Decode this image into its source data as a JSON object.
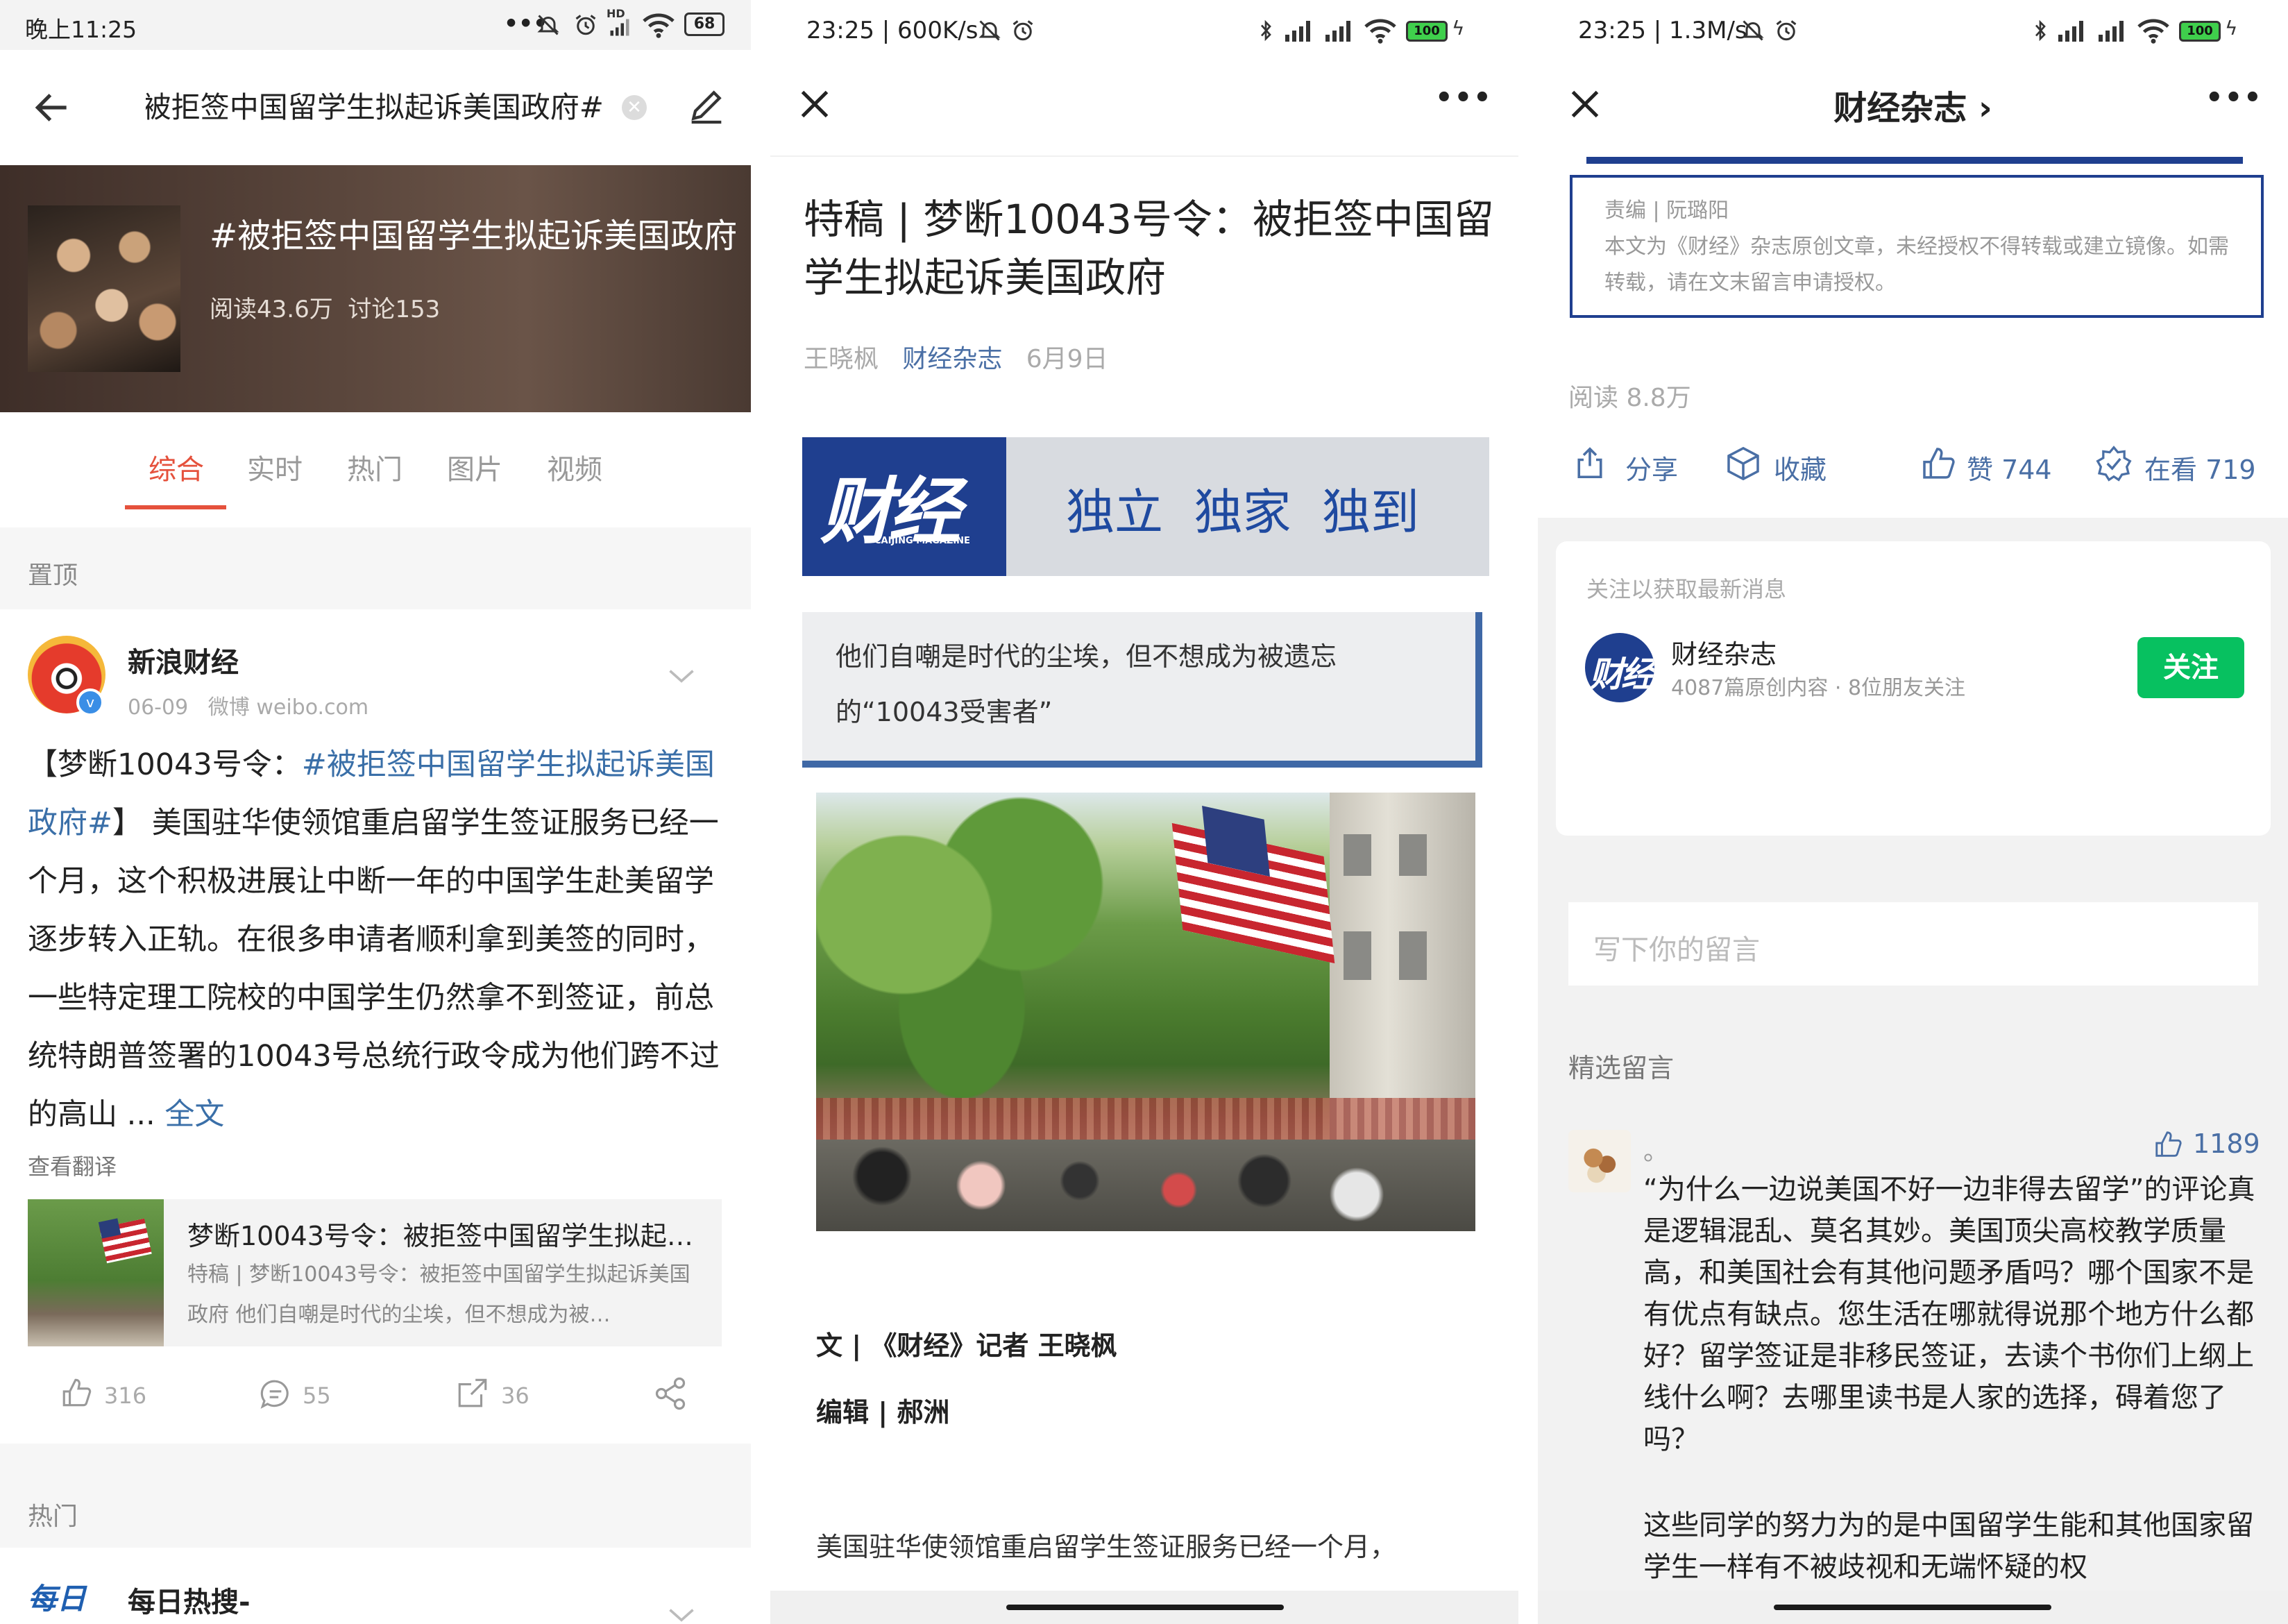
{
  "weibo": {
    "status": {
      "time": "晚上11:25",
      "signal": "HD",
      "battery": "68"
    },
    "search_query": "#被拒签中国留学生拟起诉美国政府#",
    "topic": {
      "title": "#被拒签中国留学生拟起诉美国政府",
      "reads": "阅读43.6万",
      "discussions": "讨论153"
    },
    "tabs": [
      "综合",
      "实时",
      "热门",
      "图片",
      "视频"
    ],
    "pinned_label": "置顶",
    "post": {
      "author": "新浪财经",
      "date": "06-09",
      "source": "微博 weibo.com",
      "text_prefix": "【梦断10043号令：",
      "text_tag": "#被拒签中国留学生拟起诉美国政府#",
      "text_body": "】 美国驻华使领馆重启留学生签证服务已经一个月，这个积极进展让中断一年的中国学生赴美留学逐步转入正轨。在很多申请者顺利拿到美签的同时，一些特定理工院校的中国学生仍然拿不到签证，前总统特朗普签署的10043号总统行政令成为他们跨不过的高山 ...",
      "text_full": "全文",
      "translate": "查看翻译",
      "card_title": "梦断10043号令：被拒签中国留学生拟起…",
      "card_desc": "特稿 | 梦断10043号令：被拒签中国留学生拟起诉美国政府 他们自嘲是时代的尘埃，但不想成为被…",
      "likes": "316",
      "comments": "55",
      "reposts": "36"
    },
    "hot_label": "热门",
    "next_author": "每日热搜-",
    "next_logo": "每日"
  },
  "article": {
    "status": {
      "time": "23:25 | 600K/s",
      "battery": "100"
    },
    "title": "特稿 | 梦断10043号令：被拒签中国留学生拟起诉美国政府",
    "author": "王晓枫",
    "account": "财经杂志",
    "date": "6月9日",
    "banner_logo": "财经",
    "banner_logo_en": "CAIJING MAGAZINE",
    "banner_slogan": "独立  独家  独到",
    "quote": "他们自嘲是时代的尘埃，但不想成为被遗忘的“10043受害者”",
    "byline_writer": "文 | 《财经》记者 王晓枫",
    "byline_editor": "编辑 | 郝洲",
    "paragraph": "美国驻华使领馆重启留学生签证服务已经一个月，"
  },
  "wechat_end": {
    "status": {
      "time": "23:25 | 1.3M/s",
      "battery": "100"
    },
    "nav_title": "财经杂志 ›",
    "editor_note_1": "责编 | 阮璐阳",
    "editor_note_2": "本文为《财经》杂志原创文章，未经授权不得转载或建立镜像。如需转载，请在文末留言申请授权。",
    "reads": "阅读 8.8万",
    "share": "分享",
    "favorite": "收藏",
    "likes": "赞 744",
    "watching": "在看 719",
    "follow_hint": "关注以获取最新消息",
    "account_name": "财经杂志",
    "account_meta": "4087篇原创内容 · 8位朋友关注",
    "account_logo": "财经",
    "follow_button": "关注",
    "comment_placeholder": "写下你的留言",
    "featured_label": "精选留言",
    "comment_user": "。",
    "comment_likes": "1189",
    "comment_text_1": "“为什么一边说美国不好一边非得去留学”的评论真是逻辑混乱、莫名其妙。美国顶尖高校教学质量高，和美国社会有其他问题矛盾吗？哪个国家不是有优点有缺点。您生活在哪就得说那个地方什么都好？留学签证是非移民签证，去读个书你们上纲上线什么啊？去哪里读书是人家的选择，碍着您了吗？",
    "comment_text_2": "这些同学的努力为的是中国留学生能和其他国家留学生一样有不被歧视和无端怀疑的权"
  }
}
